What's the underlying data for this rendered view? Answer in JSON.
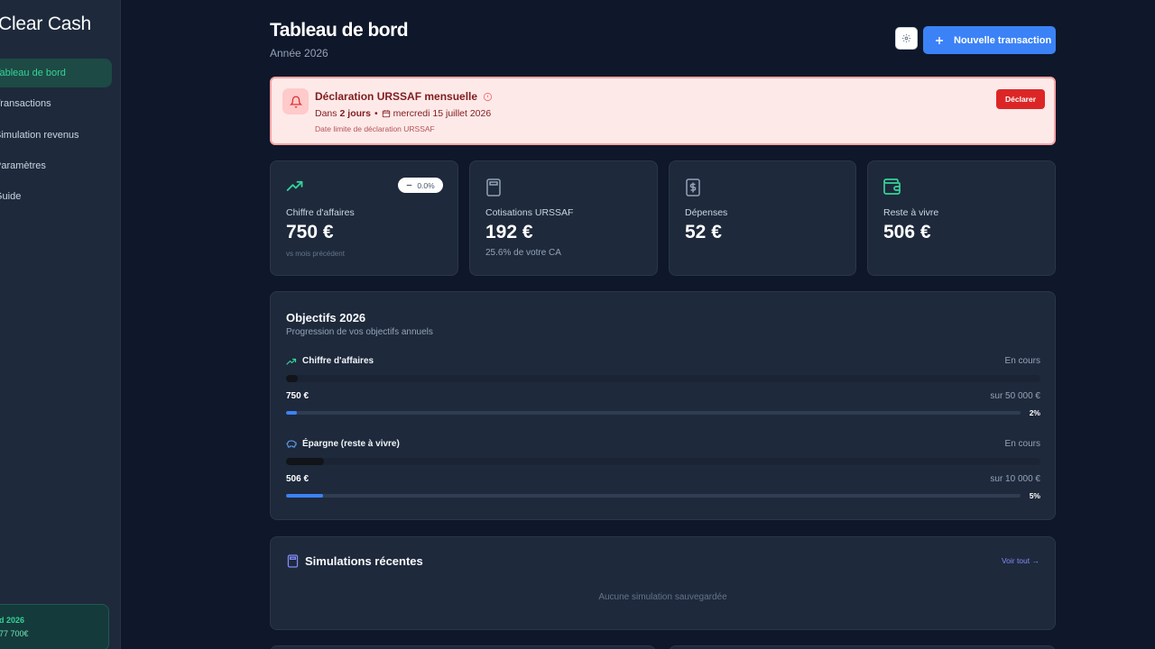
{
  "sidebar": {
    "brand": "Clear Cash",
    "items": [
      {
        "label": "Tableau de bord",
        "active": true
      },
      {
        "label": "Transactions",
        "active": false
      },
      {
        "label": "Simulation revenus",
        "active": false
      },
      {
        "label": "Paramètres",
        "active": false
      },
      {
        "label": "Guide",
        "active": false
      }
    ],
    "card": {
      "line1": "d 2026",
      "line2": "77 700€"
    }
  },
  "header": {
    "title": "Tableau de bord",
    "subtitle": "Année 2026",
    "settings_icon": "gear-icon",
    "new_button": "Nouvelle transaction"
  },
  "alert": {
    "title": "Déclaration URSSAF mensuelle",
    "prefix": "Dans",
    "days": "2 jours",
    "separator": "•",
    "date": "mercredi 15 juillet 2026",
    "footnote": "Date limite de déclaration URSSAF",
    "action": "Déclarer"
  },
  "stats": [
    {
      "label": "Chiffre d'affaires",
      "value": "750 €",
      "note": "vs mois précédent",
      "badge": "0.0%",
      "icon": "trending-up-icon"
    },
    {
      "label": "Cotisations URSSAF",
      "value": "192 €",
      "note": "25.6% de votre CA",
      "icon": "calculator-icon"
    },
    {
      "label": "Dépenses",
      "value": "52 €",
      "icon": "receipt-icon"
    },
    {
      "label": "Reste à vivre",
      "value": "506 €",
      "icon": "wallet-icon"
    }
  ],
  "goals": {
    "title": "Objectifs 2026",
    "subtitle": "Progression de vos objectifs annuels",
    "items": [
      {
        "name": "Chiffre d'affaires",
        "status": "En cours",
        "value": "750 €",
        "target": "sur 50 000 €",
        "percent_label": "2%",
        "progress": 0.015
      },
      {
        "name": "Épargne (reste à vivre)",
        "status": "En cours",
        "value": "506 €",
        "target": "sur 10 000 €",
        "percent_label": "5%",
        "progress": 0.0506
      }
    ]
  },
  "simulations": {
    "title": "Simulations récentes",
    "link": "Voir tout →",
    "empty": "Aucune simulation sauvegardée"
  },
  "colors": {
    "accent": "#3b82f6",
    "success": "#34d399",
    "danger": "#dc2626",
    "background": "#0f172a",
    "card": "#1e293b"
  }
}
